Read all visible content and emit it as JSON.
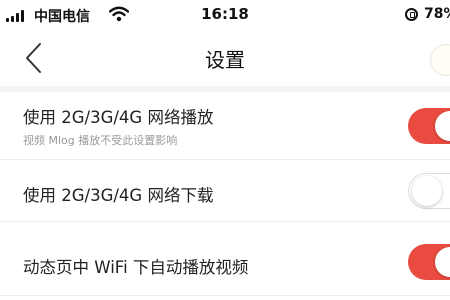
{
  "status_bar": {
    "carrier": "中国电信",
    "time": "16:18",
    "battery": "78%",
    "icons": [
      "signal-icon",
      "wifi-icon",
      "rotation-lock-icon"
    ]
  },
  "nav": {
    "title": "设置",
    "back_icon": "chevron-left-icon"
  },
  "settings": [
    {
      "label": "使用 2G/3G/4G 网络播放",
      "sublabel": "视频 Mlog 播放不受此设置影响",
      "enabled": true
    },
    {
      "label": "使用 2G/3G/4G 网络下载",
      "enabled": false
    },
    {
      "label": "动态页中 WiFi 下自动播放视频",
      "enabled": true
    }
  ],
  "colors": {
    "toggle_on": "#ea4b40",
    "toggle_off": "#ffffff",
    "separator": "#ececec",
    "section_gap": "#f4f4f4"
  }
}
